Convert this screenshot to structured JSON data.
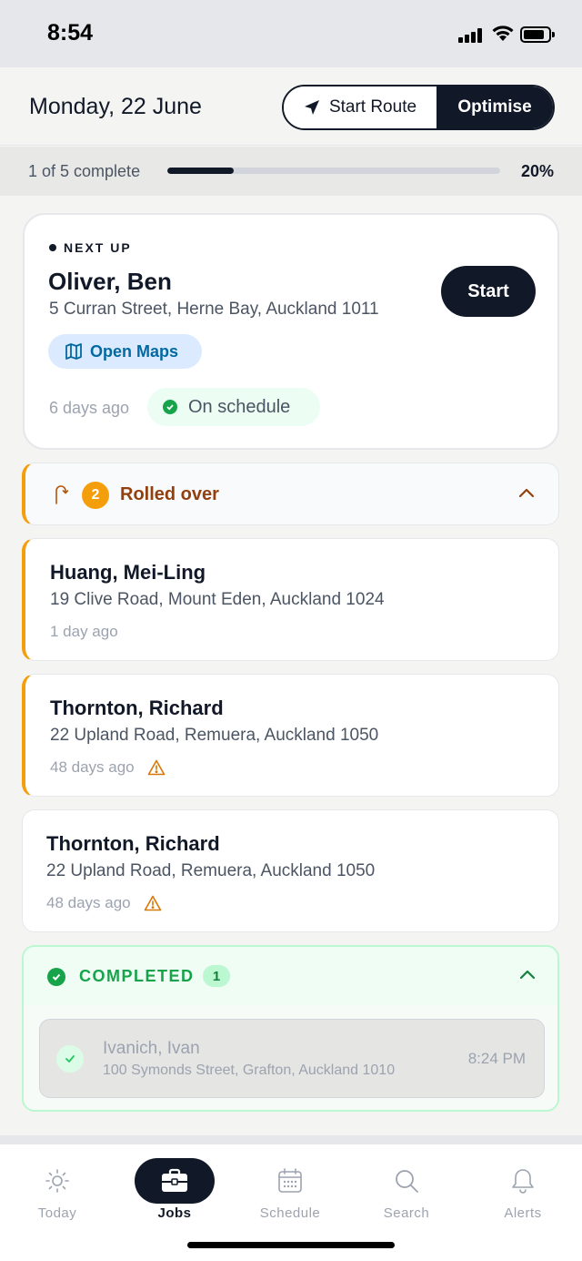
{
  "status_bar": {
    "time": "8:54"
  },
  "header": {
    "date": "Monday, 22 June",
    "start_route_label": "Start Route",
    "optimise_label": "Optimise"
  },
  "progress": {
    "label": "1 of 5 complete",
    "percent_label": "20%",
    "fraction": 0.2
  },
  "next_up": {
    "label": "NEXT UP",
    "name": "Oliver, Ben",
    "address": "5 Curran Street, Herne Bay, Auckland 1011",
    "maps_label": "Open Maps",
    "age": "6 days ago",
    "schedule_status": "On schedule",
    "start_label": "Start"
  },
  "rolled_over": {
    "count": "2",
    "label": "Rolled over",
    "jobs": [
      {
        "name": "Huang, Mei-Ling",
        "address": "19 Clive Road, Mount Eden, Auckland 1024",
        "age": "1 day ago",
        "warning": false
      },
      {
        "name": "Thornton, Richard",
        "address": "22 Upland Road, Remuera, Auckland 1050",
        "age": "48 days ago",
        "warning": true
      }
    ]
  },
  "other_job": {
    "name": "Thornton, Richard",
    "address": "22 Upland Road, Remuera, Auckland 1050",
    "age": "48 days ago",
    "warning": true
  },
  "completed": {
    "label": "COMPLETED",
    "count": "1",
    "jobs": [
      {
        "name": "Ivanich, Ivan",
        "address": "100 Symonds Street, Grafton, Auckland 1010",
        "time": "8:24 PM"
      }
    ]
  },
  "tabs": [
    {
      "label": "Today",
      "icon": "sun-icon",
      "active": false
    },
    {
      "label": "Jobs",
      "icon": "briefcase-icon",
      "active": true
    },
    {
      "label": "Schedule",
      "icon": "calendar-icon",
      "active": false
    },
    {
      "label": "Search",
      "icon": "search-icon",
      "active": false
    },
    {
      "label": "Alerts",
      "icon": "bell-icon",
      "active": false
    }
  ],
  "colors": {
    "primary": "#111827",
    "rolled_accent": "#f59e0b",
    "success": "#16a34a",
    "link": "#0369a1"
  }
}
